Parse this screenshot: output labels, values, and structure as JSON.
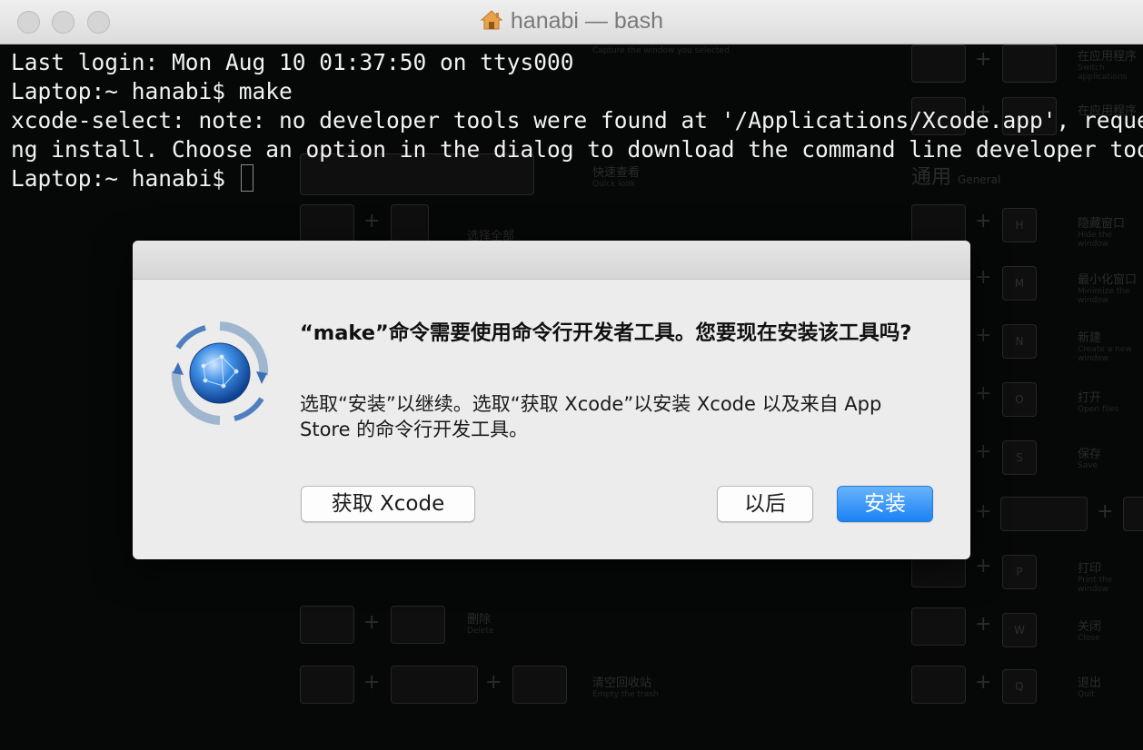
{
  "window": {
    "title": "hanabi — bash",
    "traffic_lights": [
      "close",
      "minimize",
      "zoom"
    ]
  },
  "terminal": {
    "lines": [
      "Last login: Mon Aug 10 01:37:50 on ttys000",
      "Laptop:~ hanabi$ make",
      "xcode-select: note: no developer tools were found at '/Applications/Xcode.app', requesti",
      "ng install. Choose an option in the dialog to download the command line developer tools.",
      "Laptop:~ hanabi$ "
    ]
  },
  "background_shortcuts": {
    "general_title": "通用",
    "general_subtitle": "General",
    "items": [
      {
        "label": "在应用程序",
        "sub": "Switch applications"
      },
      {
        "label": "在应用程序",
        "sub": ""
      },
      {
        "label": "快速查看",
        "sub": "Quick look"
      },
      {
        "label": "选择全部",
        "sub": ""
      },
      {
        "label": "隐藏窗口",
        "sub": "Hide the window"
      },
      {
        "label": "最小化窗口",
        "sub": "Minimize the window"
      },
      {
        "label": "新建",
        "sub": "Create a new window"
      },
      {
        "label": "打开",
        "sub": "Open files"
      },
      {
        "label": "保存",
        "sub": "Save"
      },
      {
        "label": "打印",
        "sub": "Print the window"
      },
      {
        "label": "删除",
        "sub": "Delete"
      },
      {
        "label": "关闭",
        "sub": "Close"
      },
      {
        "label": "清空回收站",
        "sub": "Empty the trash"
      },
      {
        "label": "退出",
        "sub": "Quit"
      }
    ],
    "keys": [
      "H",
      "M",
      "N",
      "O",
      "S",
      "P",
      "W",
      "Q"
    ],
    "capture_text": "Capture the window you selected"
  },
  "dialog": {
    "heading": "“make”命令需要使用命令行开发者工具。您要现在安装该工具吗?",
    "message": "选取“安装”以继续。选取“获取 Xcode”以安装 Xcode 以及来自 App Store 的命令行开发工具。",
    "buttons": {
      "get_xcode": "获取 Xcode",
      "later": "以后",
      "install": "安装"
    },
    "icon": "software-update-globe-icon"
  },
  "colors": {
    "terminal_bg": "#060707",
    "terminal_text": "#f2f2f2",
    "primary_button": "#1b82f5"
  }
}
